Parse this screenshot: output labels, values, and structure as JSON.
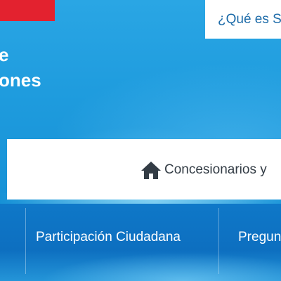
{
  "header": {
    "top_link_label": "¿Qué es SEC?",
    "brand_line1": "e",
    "brand_line2": "ones"
  },
  "breadcrumb": {
    "icon": "home-icon",
    "text": "Concesionarios y"
  },
  "nav": {
    "items": [
      {
        "label": "Participación Ciudadana"
      },
      {
        "label": "Preguntas"
      }
    ]
  },
  "colors": {
    "accent_red": "#e3222f",
    "hero_blue": "#1f9cde",
    "nav_blue": "#0d6fc0",
    "link_blue": "#1b6aa8"
  }
}
